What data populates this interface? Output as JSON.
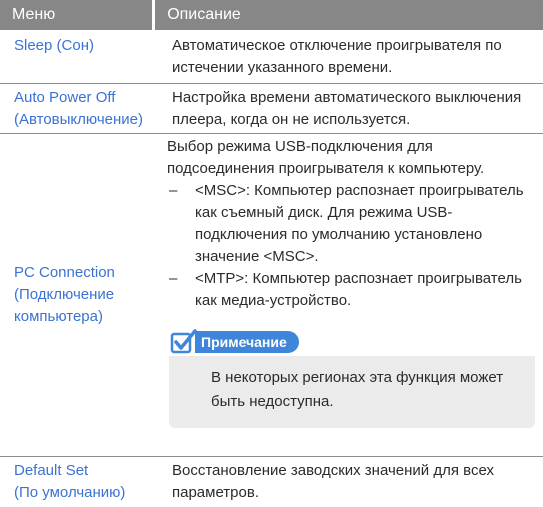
{
  "header": {
    "menu": "Меню",
    "description": "Описание"
  },
  "rows": [
    {
      "name_lines": [
        "Sleep (Сон)"
      ],
      "desc": "Автоматическое отключение проигрывателя по истечении указанного времени."
    },
    {
      "name_lines": [
        "Auto Power Off",
        "(Автовыключение)"
      ],
      "desc": "Настройка времени автоматического выключения плеера, когда он не используется."
    },
    {
      "name_lines": [
        "PC Connection",
        "(Подключение",
        "компьютера)"
      ],
      "desc": "Выбор режима USB-подключения для подсоединения проигрывателя к компьютеру.",
      "bullets": [
        {
          "dash": "–",
          "text": "<MSC>: Компьютер распознает проигрыватель как съемный диск. Для режима USB-подключения по умолчанию установлено значение <MSC>."
        },
        {
          "dash": "–",
          "text": "<MTP>: Компьютер распознает проигрыватель как медиа-устройство."
        }
      ],
      "note": {
        "label": "Примечание",
        "text": "В некоторых регионах эта функция может быть недоступна.",
        "icon": "note-checkbox-icon"
      }
    },
    {
      "name_lines": [
        "Default Set",
        "(По умолчанию)"
      ],
      "desc": "Восстановление заводских значений для всех параметров."
    }
  ],
  "colors": {
    "header_bg": "#878787",
    "menu_text": "#3a73d2",
    "note_accent": "#3f85d9",
    "note_bg": "#ebebeb"
  }
}
